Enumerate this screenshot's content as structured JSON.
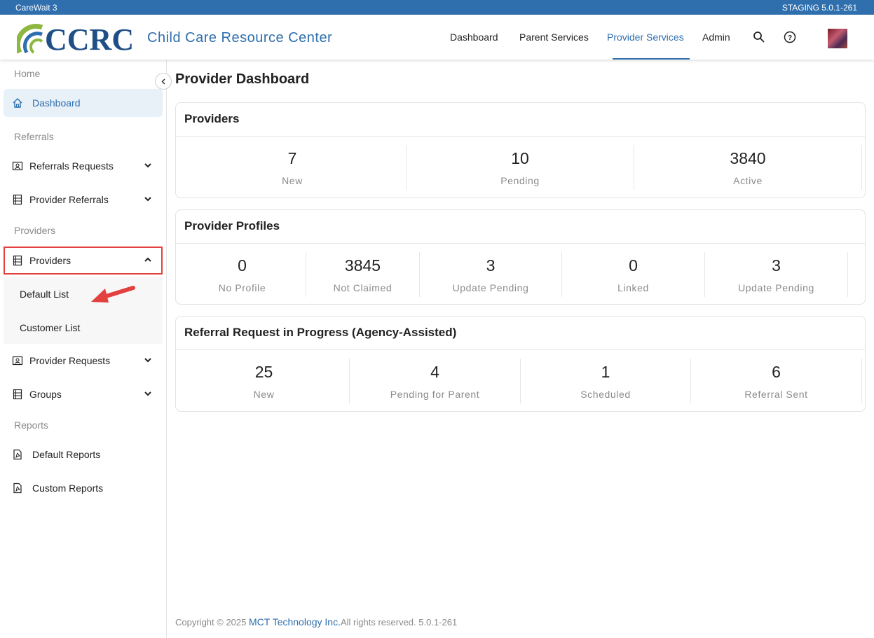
{
  "window": {
    "app_name": "CareWait 3",
    "environment": "STAGING 5.0.1-261"
  },
  "brand": {
    "logo_text": "CCRC",
    "subtitle": "Child Care Resource Center",
    "colors": {
      "primary": "#2f6fad",
      "logo_green": "#8db83f",
      "highlight": "#e2413f"
    }
  },
  "nav": {
    "items": [
      "Dashboard",
      "Parent Services",
      "Provider Services",
      "Admin"
    ],
    "active": "Provider Services",
    "icons": [
      "search-icon",
      "help-icon",
      "avatar"
    ]
  },
  "sidebar": {
    "sections": {
      "home": "Home",
      "referrals": "Referrals",
      "providers": "Providers",
      "reports": "Reports"
    },
    "items": {
      "dashboard": "Dashboard",
      "referrals_requests": "Referrals Requests",
      "provider_referrals": "Provider Referrals",
      "providers": "Providers",
      "default_list": "Default List",
      "customer_list": "Customer List",
      "provider_requests": "Provider Requests",
      "groups": "Groups",
      "default_reports": "Default Reports",
      "custom_reports": "Custom Reports"
    }
  },
  "page": {
    "title": "Provider Dashboard"
  },
  "cards": [
    {
      "title": "Providers",
      "stats": [
        {
          "value": "7",
          "label": "New"
        },
        {
          "value": "10",
          "label": "Pending"
        },
        {
          "value": "3840",
          "label": "Active"
        }
      ]
    },
    {
      "title": "Provider Profiles",
      "stats": [
        {
          "value": "0",
          "label": "No Profile"
        },
        {
          "value": "3845",
          "label": "Not Claimed"
        },
        {
          "value": "3",
          "label": "Update Pending"
        },
        {
          "value": "0",
          "label": "Linked"
        },
        {
          "value": "3",
          "label": "Update Pending"
        }
      ]
    },
    {
      "title": "Referral Request in Progress (Agency-Assisted)",
      "stats": [
        {
          "value": "25",
          "label": "New"
        },
        {
          "value": "4",
          "label": "Pending for Parent"
        },
        {
          "value": "1",
          "label": "Scheduled"
        },
        {
          "value": "6",
          "label": "Referral Sent"
        }
      ]
    }
  ],
  "footer": {
    "prefix": "Copyright © 2025 ",
    "company": "MCT Technology Inc.",
    "suffix": "All rights reserved. 5.0.1-261"
  }
}
